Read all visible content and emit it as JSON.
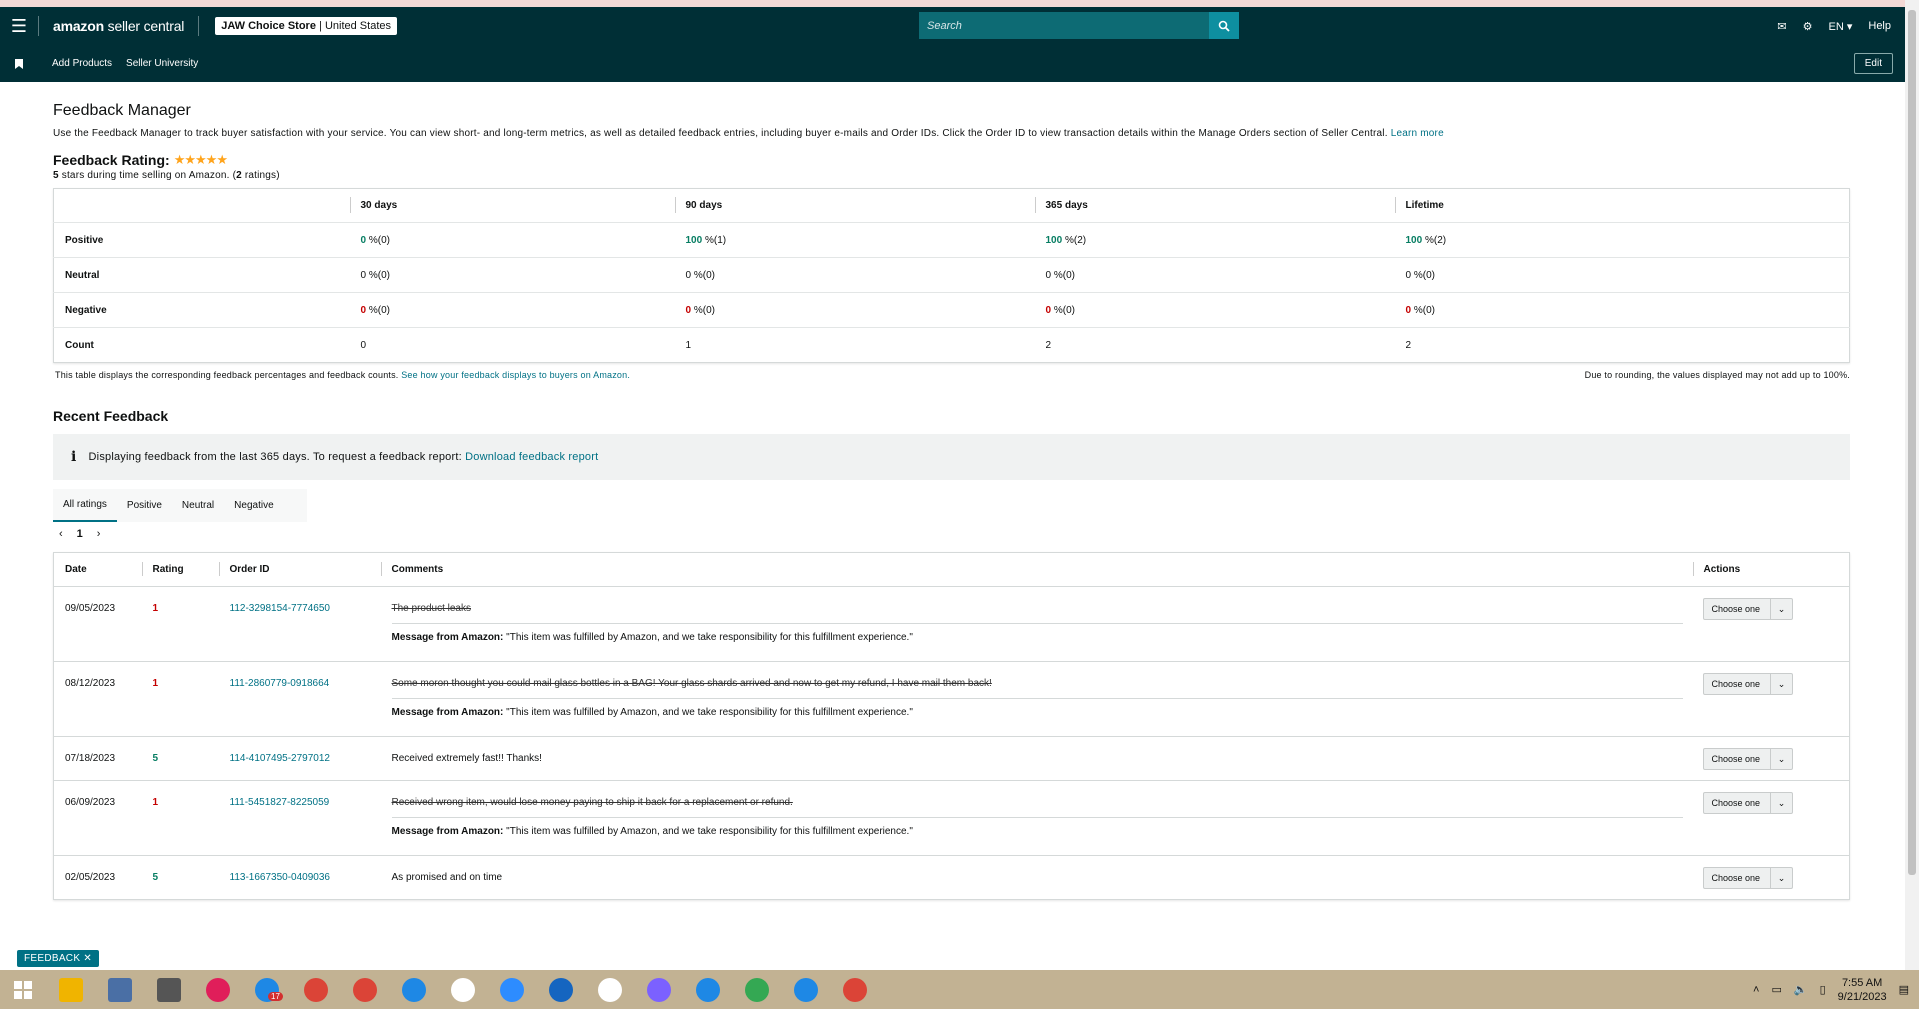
{
  "header": {
    "logo_bold": "amazon",
    "logo_rest": "seller central",
    "store_name": "JAW Choice Store",
    "store_region": "United States",
    "search_placeholder": "Search",
    "language": "EN",
    "help": "Help"
  },
  "subnav": {
    "items": [
      "Add Products",
      "Seller University"
    ],
    "edit": "Edit"
  },
  "page": {
    "title": "Feedback Manager",
    "description": "Use the Feedback Manager to track buyer satisfaction with your service. You can view short- and long-term metrics, as well as detailed feedback entries, including buyer e-mails and Order IDs. Click the Order ID to view transaction details within the Manage Orders section of Seller Central.",
    "learn_more": "Learn more",
    "rating_title": "Feedback Rating:",
    "stars": "★★★★★",
    "rating_sub_strong": "5",
    "rating_sub": "stars during time selling on Amazon. (",
    "rating_count": "2",
    "rating_sub_end": "ratings)"
  },
  "metrics": {
    "columns": [
      "30 days",
      "90 days",
      "365 days",
      "Lifetime"
    ],
    "rows": [
      {
        "label": "Positive",
        "cells": [
          {
            "v": "0",
            "s": " %(0)"
          },
          {
            "v": "100",
            "s": " %(1)"
          },
          {
            "v": "100",
            "s": " %(2)"
          },
          {
            "v": "100",
            "s": " %(2)"
          }
        ]
      },
      {
        "label": "Neutral",
        "cells": [
          {
            "v": "0",
            "s": " %(0)"
          },
          {
            "v": "0",
            "s": " %(0)"
          },
          {
            "v": "0",
            "s": " %(0)"
          },
          {
            "v": "0",
            "s": " %(0)"
          }
        ]
      },
      {
        "label": "Negative",
        "cells": [
          {
            "v": "0",
            "s": " %(0)"
          },
          {
            "v": "0",
            "s": " %(0)"
          },
          {
            "v": "0",
            "s": " %(0)"
          },
          {
            "v": "0",
            "s": " %(0)"
          }
        ]
      },
      {
        "label": "Count",
        "cells": [
          {
            "v": "",
            "s": "0"
          },
          {
            "v": "",
            "s": "1"
          },
          {
            "v": "",
            "s": "2"
          },
          {
            "v": "",
            "s": "2"
          }
        ]
      }
    ],
    "note": "This table displays the corresponding feedback percentages and feedback counts.",
    "note_link": "See how your feedback displays to buyers on Amazon.",
    "rounding": "Due to rounding, the values displayed may not add up to 100%."
  },
  "recent": {
    "title": "Recent Feedback",
    "info": "Displaying feedback from the last 365 days. To request a feedback report:",
    "info_link": "Download feedback report",
    "tabs": [
      "All ratings",
      "Positive",
      "Neutral",
      "Negative"
    ],
    "page": "1",
    "columns": [
      "Date",
      "Rating",
      "Order ID",
      "Comments",
      "Actions"
    ],
    "action_label": "Choose one",
    "msg_label": "Message from Amazon:",
    "msg_text": "\"This item was fulfilled by Amazon, and we take responsibility for this fulfillment experience.\"",
    "rows": [
      {
        "date": "09/05/2023",
        "rating": "1",
        "order": "112-3298154-7774650",
        "comment": "The product leaks",
        "struck": true
      },
      {
        "date": "08/12/2023",
        "rating": "1",
        "order": "111-2860779-0918664",
        "comment": "Some moron thought you could mail glass bottles in a BAG! Your glass shards arrived and now to get my refund, I have mail them back!",
        "struck": true
      },
      {
        "date": "07/18/2023",
        "rating": "5",
        "order": "114-4107495-2797012",
        "comment": "Received extremely fast!! Thanks!",
        "struck": false
      },
      {
        "date": "06/09/2023",
        "rating": "1",
        "order": "111-5451827-8225059",
        "comment": "Received wrong item, would lose money paying to ship it back for a replacement or refund.",
        "struck": true
      },
      {
        "date": "02/05/2023",
        "rating": "5",
        "order": "113-1667350-0409036",
        "comment": "As promised and on time",
        "struck": false
      }
    ]
  },
  "feedback_tag": "FEEDBACK ✕",
  "taskbar": {
    "time": "7:55 AM",
    "date": "9/21/2023",
    "badge": "17",
    "icon_colors": [
      "#f0b400",
      "#4a6fa5",
      "#555555",
      "#e01e5a",
      "#1e88e5",
      "#db4437",
      "#db4437",
      "#1e88e5",
      "#ffffff",
      "#2d8cff",
      "#1565c0",
      "#ffffff",
      "#7b61ff",
      "#1e88e5",
      "#34a853",
      "#1e88e5",
      "#db4437"
    ]
  }
}
